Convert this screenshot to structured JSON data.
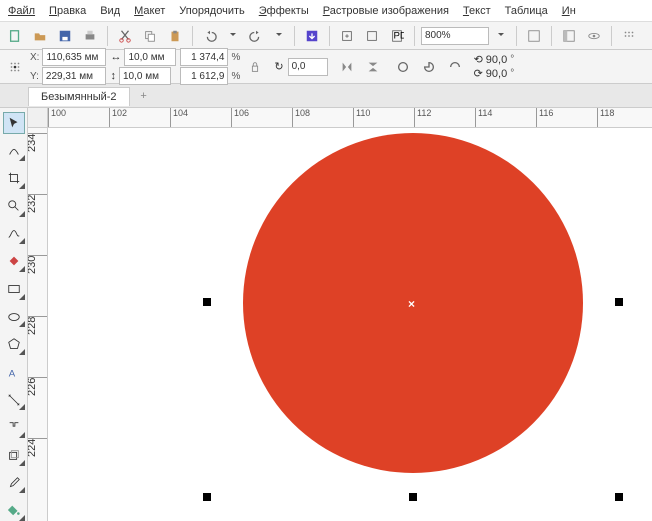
{
  "menu": {
    "file": "Файл",
    "edit": "Правка",
    "view": "Вид",
    "layout": "Макет",
    "arrange": "Упорядочить",
    "effects": "Эффекты",
    "bitmaps": "Растровые изображения",
    "text": "Текст",
    "table": "Таблица",
    "tools": "Инструменты"
  },
  "zoom": "800%",
  "props": {
    "x_lbl": "X:",
    "x": "110,635 мм",
    "y_lbl": "Y:",
    "y": "229,31 мм",
    "w": "10,0 мм",
    "h": "10,0 мм",
    "sx": "1 374,4",
    "sy": "1 612,9",
    "pct": "%",
    "rot_lbl": "0,0",
    "rot": "0,0",
    "ang1": "90,0",
    "ang2": "90,0",
    "deg": "°"
  },
  "tab": {
    "name": "Безымянный-2",
    "plus": "+"
  },
  "ruler_h": [
    "100",
    "102",
    "104",
    "106",
    "108",
    "110",
    "112",
    "114",
    "116",
    "118"
  ],
  "ruler_v": [
    "234",
    "232",
    "230",
    "228",
    "226",
    "224"
  ],
  "shape_color": "#de4126"
}
